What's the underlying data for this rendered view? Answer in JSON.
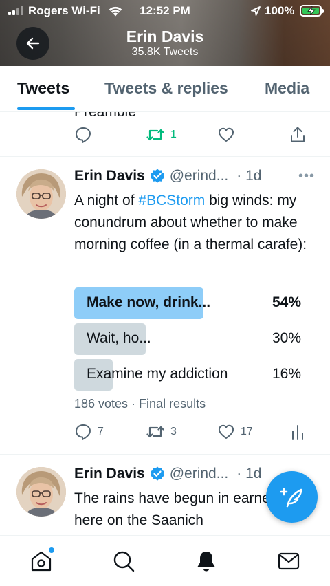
{
  "status_bar": {
    "carrier": "Rogers Wi-Fi",
    "time": "12:52 PM",
    "battery": "100%"
  },
  "header": {
    "title": "Erin Davis",
    "subtitle": "35.8K Tweets"
  },
  "tabs": [
    {
      "label": "Tweets",
      "active": true
    },
    {
      "label": "Tweets & replies",
      "active": false
    },
    {
      "label": "Media",
      "active": false
    }
  ],
  "previous_tweet": {
    "partial_text": "Preamble",
    "retweet_count": "1"
  },
  "tweet1": {
    "author_name": "Erin Davis",
    "handle": "@erind...",
    "time": "· 1d",
    "text_before": "A night of ",
    "hashtag": "#BCStorm",
    "text_after": " big winds: my conundrum about whether to make morning coffee (in a thermal carafe):",
    "poll": {
      "options": [
        {
          "label": "Make now, drink...",
          "percent": "54%",
          "value": 54,
          "winner": true
        },
        {
          "label": "Wait, ho...",
          "percent": "30%",
          "value": 30,
          "winner": false
        },
        {
          "label": "Examine my addiction",
          "percent": "16%",
          "value": 16,
          "winner": false
        }
      ],
      "meta": "186 votes · Final results"
    },
    "replies": "7",
    "retweets": "3",
    "likes": "17"
  },
  "tweet2": {
    "author_name": "Erin Davis",
    "handle": "@erind...",
    "time": "· 1d",
    "text": "The rains have begun in earnest here on the Saanich"
  },
  "colors": {
    "accent": "#1d9bf0",
    "retweet_green": "#00ba7c",
    "secondary_text": "#536471"
  }
}
